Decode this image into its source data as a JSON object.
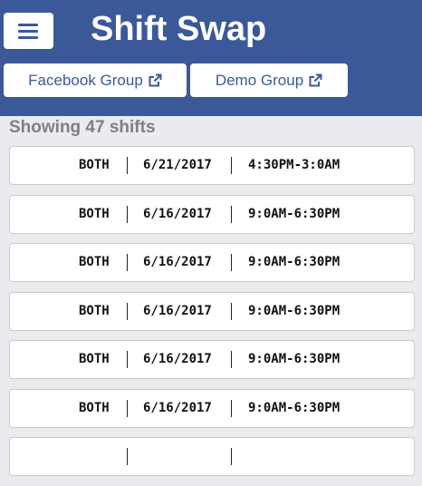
{
  "app": {
    "title": "Shift Swap"
  },
  "header": {
    "menu_icon": "hamburger-menu-icon",
    "links": [
      {
        "label": "Facebook Group",
        "icon": "external-link-icon"
      },
      {
        "label": "Demo Group",
        "icon": "external-link-icon"
      }
    ]
  },
  "list": {
    "count_label": "Showing 47 shifts",
    "shifts": [
      {
        "type": "BOTH",
        "date": "6/21/2017",
        "time": "4:30PM-3:0AM"
      },
      {
        "type": "BOTH",
        "date": "6/16/2017",
        "time": "9:0AM-6:30PM"
      },
      {
        "type": "BOTH",
        "date": "6/16/2017",
        "time": "9:0AM-6:30PM"
      },
      {
        "type": "BOTH",
        "date": "6/16/2017",
        "time": "9:0AM-6:30PM"
      },
      {
        "type": "BOTH",
        "date": "6/16/2017",
        "time": "9:0AM-6:30PM"
      },
      {
        "type": "BOTH",
        "date": "6/16/2017",
        "time": "9:0AM-6:30PM"
      },
      {
        "type": "",
        "date": "",
        "time": ""
      }
    ]
  },
  "colors": {
    "brand": "#3b5998",
    "page_background": "#e9ebee",
    "count_text": "#808080"
  }
}
